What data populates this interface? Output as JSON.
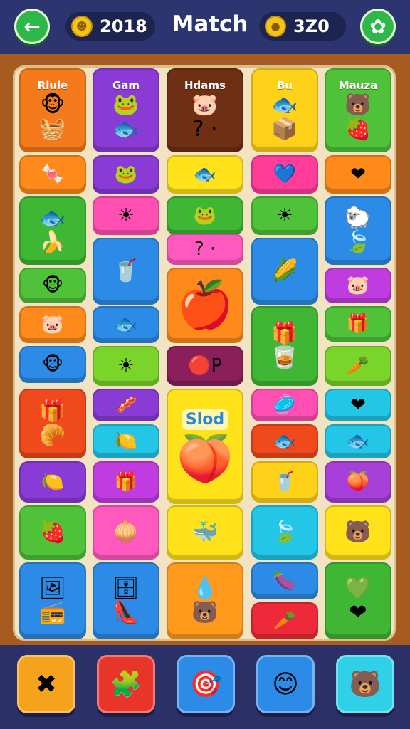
{
  "header": {
    "back_icon": "←",
    "score_coin_icon": "☻",
    "score": "2018",
    "title": "Match",
    "coin_icon": "●",
    "coins": "3Z0",
    "settings_icon": "✿"
  },
  "board": {
    "column_labels": [
      "Rlule",
      "Gam",
      "Hdams",
      "Bu",
      "Mauza"
    ],
    "special_label": "Slod",
    "tiles": [
      {
        "color": "#f57a1c",
        "glyphs": [
          "🐵",
          "🧺"
        ]
      },
      {
        "color": "#8a3bd6",
        "glyphs": [
          "🐸",
          "🐟"
        ]
      },
      {
        "color": "#6e2f14",
        "glyphs": [
          "🐷",
          "? ·"
        ]
      },
      {
        "color": "#ffd21a",
        "glyphs": [
          "🐟",
          "📦"
        ]
      },
      {
        "color": "#4fc23a",
        "glyphs": [
          "🐻",
          "🍓"
        ]
      },
      {
        "color": "#ff8a1c",
        "glyphs": [
          "🍬"
        ]
      },
      {
        "color": "#8a3bd6",
        "glyphs": [
          "🐸"
        ]
      },
      {
        "color": "#ffe21a",
        "glyphs": [
          "🐟"
        ]
      },
      {
        "color": "#ff3c9a",
        "glyphs": [
          "💙"
        ]
      },
      {
        "color": "#ff8a1c",
        "glyphs": [
          "❤"
        ]
      },
      {
        "color": "#3fb634",
        "glyphs": [
          "🐟",
          "🍌"
        ]
      },
      {
        "color": "#ff4fb3",
        "glyphs": [
          "☀"
        ]
      },
      {
        "color": "#3fb634",
        "glyphs": [
          "🐸"
        ]
      },
      {
        "color": "#4fc23a",
        "glyphs": [
          "☀"
        ]
      },
      {
        "color": "#2b8be6",
        "glyphs": [
          "🐑",
          "🍃"
        ]
      },
      {
        "color": "#2b8be6",
        "glyphs": [
          "🥤"
        ]
      },
      {
        "color": "#ff59c0",
        "glyphs": [
          "? ·"
        ]
      },
      {
        "color": "#2b8be6",
        "glyphs": [
          "🌽"
        ]
      },
      {
        "color": "#c13ce0",
        "glyphs": [
          "🐷"
        ]
      },
      {
        "color": "#4fc23a",
        "glyphs": [
          "🐵"
        ]
      },
      {
        "color": "#ff8a1c",
        "glyphs": [
          "🍎"
        ]
      },
      {
        "color": "#ff8a1c",
        "glyphs": [
          "🐷"
        ]
      },
      {
        "color": "#2b8be6",
        "glyphs": [
          "🐟"
        ]
      },
      {
        "color": "#3fb634",
        "glyphs": [
          "🎁",
          "🥃"
        ]
      },
      {
        "color": "#4fc23a",
        "glyphs": [
          "🎁"
        ]
      },
      {
        "color": "#2b8be6",
        "glyphs": [
          "🐵"
        ]
      },
      {
        "color": "#7bd42a",
        "glyphs": [
          "☀"
        ]
      },
      {
        "color": "#8a1f5c",
        "glyphs": [
          "🔴P"
        ]
      },
      {
        "color": "#7bd42a",
        "glyphs": [
          "🥕"
        ]
      },
      {
        "color": "#f04a1c",
        "glyphs": [
          "🎁",
          "🥐"
        ]
      },
      {
        "color": "#8a3bd6",
        "glyphs": [
          "🥓"
        ]
      },
      {
        "color": "#ffe21a",
        "glyphs": [
          "🍑"
        ]
      },
      {
        "color": "#ff4fb3",
        "glyphs": [
          "🥏"
        ]
      },
      {
        "color": "#24c6e8",
        "glyphs": [
          "❤"
        ]
      },
      {
        "color": "#24c6e8",
        "glyphs": [
          "🍋"
        ]
      },
      {
        "color": "#f04a1c",
        "glyphs": [
          "🐟"
        ]
      },
      {
        "color": "#24c6e8",
        "glyphs": [
          "🐟"
        ]
      },
      {
        "color": "#8a3bd6",
        "glyphs": [
          "🍋"
        ]
      },
      {
        "color": "#c13ce0",
        "glyphs": [
          "🎁"
        ]
      },
      {
        "color": "#ffd21a",
        "glyphs": [
          "🥤"
        ]
      },
      {
        "color": "#a640d8",
        "glyphs": [
          "🍑"
        ]
      },
      {
        "color": "#4fc23a",
        "glyphs": [
          "🍓"
        ]
      },
      {
        "color": "#ff59c0",
        "glyphs": [
          "🧅"
        ]
      },
      {
        "color": "#ffe21a",
        "glyphs": [
          "🐳"
        ]
      },
      {
        "color": "#24c6e8",
        "glyphs": [
          "🍃"
        ]
      },
      {
        "color": "#ffe21a",
        "glyphs": [
          "🐻"
        ]
      },
      {
        "color": "#2b8be6",
        "glyphs": [
          "🖼",
          "📻"
        ]
      },
      {
        "color": "#2b8be6",
        "glyphs": [
          "🗄",
          "👠"
        ]
      },
      {
        "color": "#ff9a1c",
        "glyphs": [
          "💧",
          "🐻"
        ]
      },
      {
        "color": "#2b8be6",
        "glyphs": [
          "🍆"
        ]
      },
      {
        "color": "#ee2a3a",
        "glyphs": [
          "🥕"
        ]
      },
      {
        "color": "#3fb634",
        "glyphs": [
          "💚",
          "❤"
        ]
      }
    ]
  },
  "powerups": [
    {
      "icon": "✖",
      "color": "#f5a21c",
      "name": "shuffle"
    },
    {
      "icon": "🧩",
      "color": "#e8352a",
      "name": "puzzle"
    },
    {
      "icon": "🎯",
      "color": "#2b8be6",
      "name": "target"
    },
    {
      "icon": "😊",
      "color": "#2b8be6",
      "name": "drop"
    },
    {
      "icon": "🐻",
      "color": "#2fd0e8",
      "name": "bear"
    }
  ]
}
